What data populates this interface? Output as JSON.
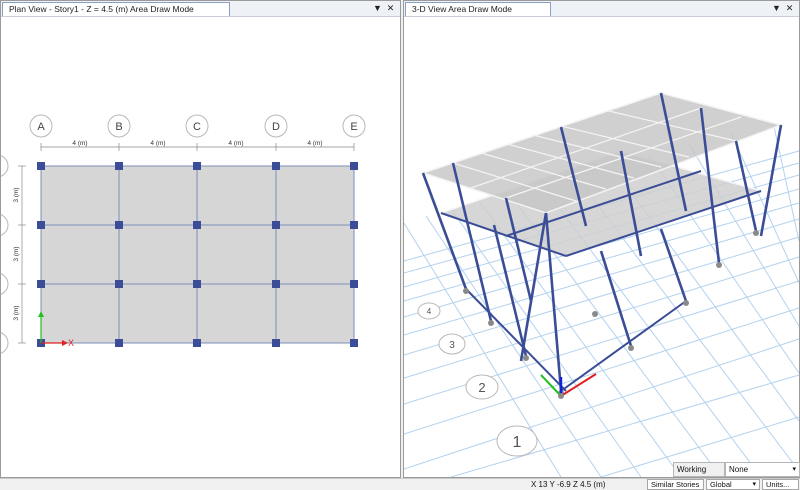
{
  "left_pane": {
    "title": "Plan View - Story1 - Z = 4.5 (m)  Area Draw Mode",
    "grid_x": [
      "A",
      "B",
      "C",
      "D",
      "E"
    ],
    "dims_x": [
      "4 (m)",
      "4 (m)",
      "4 (m)",
      "4 (m)"
    ],
    "dims_y": [
      "3 (m)",
      "3 (m)",
      "3 (m)"
    ],
    "axis_x": "X",
    "dropdown_glyph": "▼",
    "close_glyph": "✕"
  },
  "right_pane": {
    "title": "3-D View  Area Draw Mode",
    "grid_labels": [
      "1",
      "2",
      "3",
      "4"
    ],
    "dropdown_glyph": "▼",
    "close_glyph": "✕"
  },
  "working_plane": {
    "label": "Working Plane",
    "value": "None"
  },
  "status_bar": {
    "coords": "X 13  Y -6.9  Z 4.5 (m)",
    "stories": "Similar Stories",
    "system": "Global",
    "units": "Units..."
  },
  "colors": {
    "column": "#3a4d96",
    "slab": "#d6d6d6",
    "grid_3d": "#b3d2ef",
    "plan_grid": "#7e8db8"
  }
}
